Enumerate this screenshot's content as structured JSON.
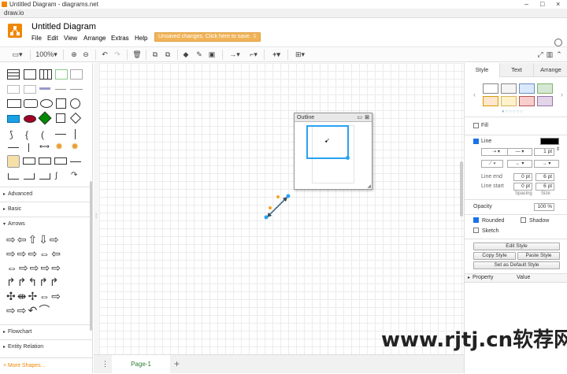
{
  "window": {
    "title": "Untitled Diagram - diagrams.net",
    "minimize": "–",
    "maximize": "□",
    "close": "×"
  },
  "tab": {
    "label": "draw.io"
  },
  "header": {
    "doc_title": "Untitled Diagram",
    "menu": [
      "File",
      "Edit",
      "View",
      "Arrange",
      "Extras",
      "Help"
    ],
    "unsaved": "Unsaved changes. Click here to save. ⇩"
  },
  "toolbar": {
    "zoom": "100%"
  },
  "left": {
    "sections": [
      "Advanced",
      "Basic",
      "Arrows",
      "Flowchart",
      "Entity Relation"
    ],
    "more_shapes": "+ More Shapes..."
  },
  "outline": {
    "title": "Outline"
  },
  "bottom": {
    "page_tab": "Page-1",
    "add": "+",
    "menu": "⋮"
  },
  "right": {
    "tabs": [
      "Style",
      "Text",
      "Arrange"
    ],
    "swatches": [
      "#ffffff",
      "#f5f5f5",
      "#dae8fc",
      "#d5e8d4",
      "#ffe6cc",
      "#fff2cc",
      "#f8cecc",
      "#e1d5e7"
    ],
    "fill": "Fill",
    "line": "Line",
    "line_color": "#000000",
    "line_width": "1 pt",
    "line_end": "Line end",
    "line_start": "Line start",
    "end_spacing": "0 pt",
    "end_size": "6 pt",
    "start_spacing": "0 pt",
    "start_size": "6 pt",
    "spacing": "Spacing",
    "size": "Size",
    "opacity": "Opacity",
    "opacity_value": "100 %",
    "rounded": "Rounded",
    "shadow": "Shadow",
    "sketch": "Sketch",
    "edit_style": "Edit Style",
    "copy_style": "Copy Style",
    "paste_style": "Paste Style",
    "set_default": "Set as Default Style",
    "property": "Property",
    "value": "Value"
  },
  "watermark": "www.rjtj.cn软荐网"
}
